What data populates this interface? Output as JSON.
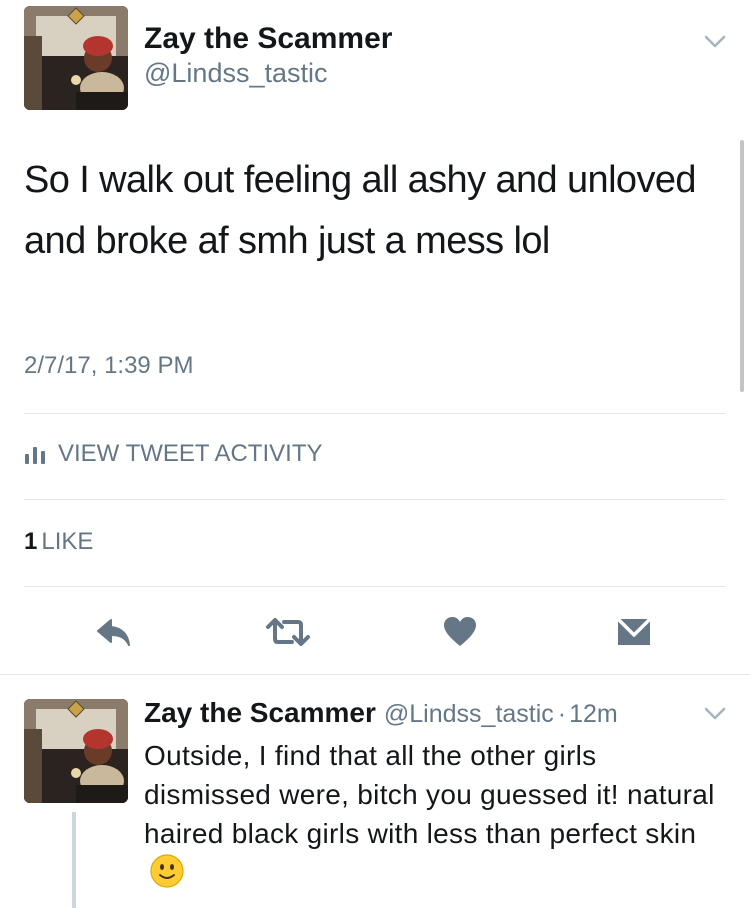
{
  "tweet": {
    "author_name": "Zay the Scammer",
    "author_handle": "@Lindss_tastic",
    "text": "So I walk out feeling all ashy and unloved and broke af smh just a mess lol",
    "timestamp": "2/7/17, 1:39 PM",
    "activity_label": "VIEW TWEET ACTIVITY",
    "like_count": "1",
    "like_label": "LIKE"
  },
  "reply": {
    "author_name": "Zay the Scammer",
    "author_handle": "@Lindss_tastic",
    "separator": "·",
    "age": "12m",
    "text": "Outside, I find that all the other girls dismissed were, bitch you guessed it! natural haired black girls with less than perfect skin"
  },
  "icons": {
    "more": "chevron-down-icon",
    "activity": "bar-chart-icon",
    "reply": "reply-icon",
    "retweet": "retweet-icon",
    "like": "heart-icon",
    "dm": "envelope-icon",
    "emoji": "slightly-smiling-face-emoji"
  },
  "colors": {
    "text": "#14171a",
    "secondary": "#657786",
    "icon": "#657786",
    "divider": "#e1e8ed"
  }
}
